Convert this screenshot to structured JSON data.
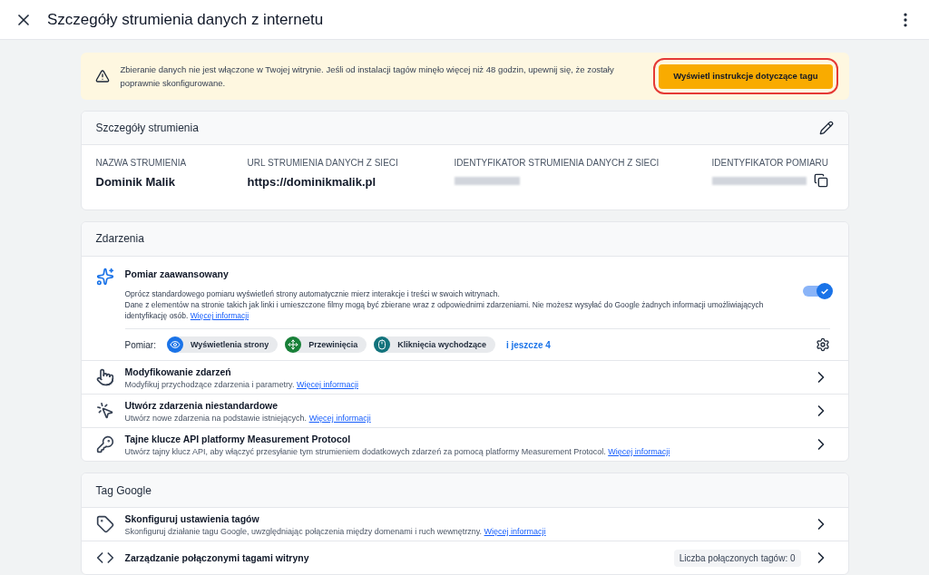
{
  "header": {
    "title": "Szczegóły strumienia danych z internetu"
  },
  "banner": {
    "message": "Zbieranie danych nie jest włączone w Twojej witrynie. Jeśli od instalacji tagów minęło więcej niż 48 godzin, upewnij się, że zostały poprawnie skonfigurowane.",
    "button": "Wyświetl instrukcje dotyczące tagu",
    "highlighted": true
  },
  "stream_details": {
    "title": "Szczegóły strumienia",
    "fields": [
      {
        "label": "NAZWA STRUMIENIA",
        "value": "Dominik Malik",
        "kind": "text"
      },
      {
        "label": "URL STRUMIENIA DANYCH Z SIECI",
        "value": "https://dominikmalik.pl",
        "kind": "text"
      },
      {
        "label": "IDENTYFIKATOR STRUMIENIA DANYCH Z SIECI",
        "kind": "blurred"
      },
      {
        "label": "IDENTYFIKATOR POMIARU",
        "kind": "blurred_copy"
      }
    ]
  },
  "events": {
    "title": "Zdarzenia",
    "enhanced": {
      "title": "Pomiar zaawansowany",
      "line1": "Oprócz standardowego pomiaru wyświetleń strony automatycznie mierz interakcje i treści w swoich witrynach.",
      "line2": "Dane z elementów na stronie takich jak linki i umieszczone filmy mogą być zbierane wraz z odpowiednimi zdarzeniami. Nie możesz wysyłać do Google żadnych informacji umożliwiających identyfikację osób.",
      "link": "Więcej informacji",
      "on": true,
      "measure_label": "Pomiar:",
      "chips": [
        {
          "label": "Wyświetlenia strony",
          "kind": "eye",
          "color": "#1a73e8"
        },
        {
          "label": "Przewinięcia",
          "kind": "scroll",
          "color": "#188038"
        },
        {
          "label": "Kliknięcia wychodzące",
          "kind": "mouse",
          "color": "#12737c"
        }
      ],
      "more": "i jeszcze 4"
    },
    "rows": [
      {
        "kind": "touch",
        "title": "Modyfikowanie zdarzeń",
        "description": "Modyfikuj przychodzące zdarzenia i parametry.",
        "link": "Więcej informacji"
      },
      {
        "kind": "click",
        "title": "Utwórz zdarzenia niestandardowe",
        "description": "Utwórz nowe zdarzenia na podstawie istniejących.",
        "link": "Więcej informacji"
      },
      {
        "kind": "key",
        "title": "Tajne klucze API platformy Measurement Protocol",
        "description": "Utwórz tajny klucz API, aby włączyć przesyłanie tym strumieniem dodatkowych zdarzeń za pomocą platformy Measurement Protocol.",
        "link": "Więcej informacji"
      }
    ]
  },
  "google_tag": {
    "title": "Tag Google",
    "rows": [
      {
        "kind": "tag",
        "title": "Skonfiguruj ustawienia tagów",
        "description": "Skonfiguruj działanie tagu Google, uwzględniając połączenia między domenami i ruch wewnętrzny.",
        "link": "Więcej informacji"
      },
      {
        "kind": "code",
        "title": "Zarządzanie połączonymi tagami witryny",
        "badge": "Liczba połączonych tagów: 0"
      }
    ]
  }
}
